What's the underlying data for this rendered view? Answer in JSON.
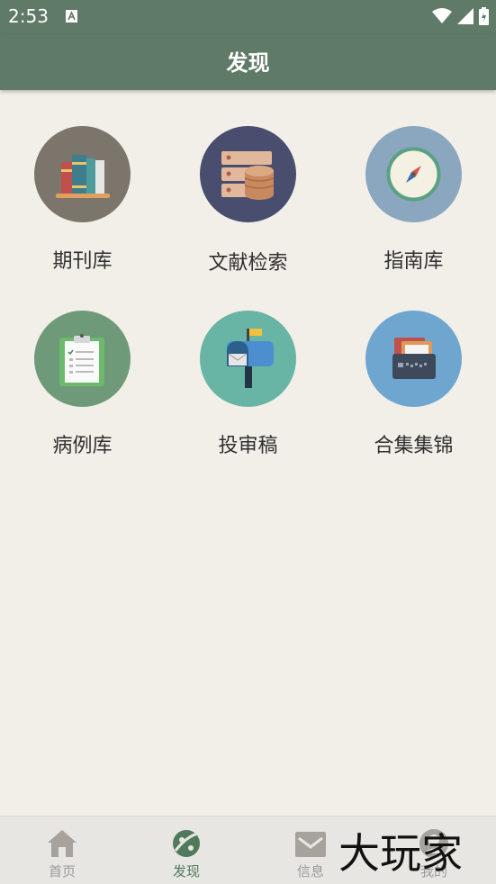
{
  "status_bar": {
    "time": "2:53"
  },
  "header": {
    "title": "发现"
  },
  "grid": [
    {
      "label": "期刊库",
      "icon": "books-icon",
      "bg": "#7b756b"
    },
    {
      "label": "文献检索",
      "icon": "database-icon",
      "bg": "#4a4e6e"
    },
    {
      "label": "指南库",
      "icon": "compass-icon",
      "bg": "#8ba6bf"
    },
    {
      "label": "病例库",
      "icon": "clipboard-icon",
      "bg": "#6f9a7a"
    },
    {
      "label": "投审稿",
      "icon": "mailbox-icon",
      "bg": "#68b5a6"
    },
    {
      "label": "合集集锦",
      "icon": "folder-icon",
      "bg": "#6ea6cf"
    }
  ],
  "bottom_nav": [
    {
      "label": "首页",
      "icon": "home-icon",
      "active": false
    },
    {
      "label": "发现",
      "icon": "discover-icon",
      "active": true
    },
    {
      "label": "信息",
      "icon": "mail-icon",
      "active": false
    },
    {
      "label": "我的",
      "icon": "profile-icon",
      "active": false
    }
  ],
  "watermark": "大玩家",
  "colors": {
    "accent": "#5f7a67",
    "background": "#f2efe8",
    "nav_active": "#4f7a5c"
  }
}
